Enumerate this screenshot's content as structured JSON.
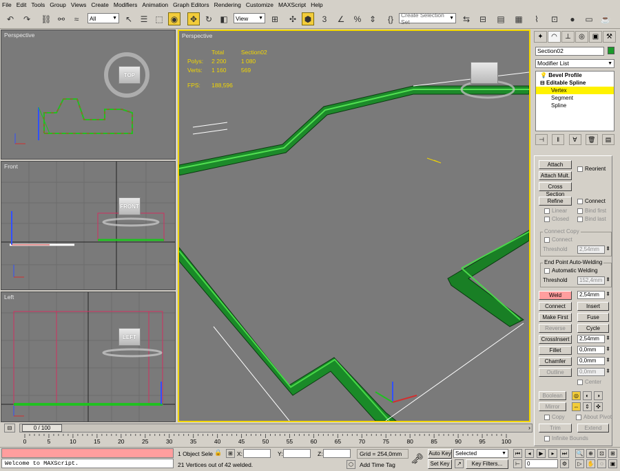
{
  "menu": [
    "File",
    "Edit",
    "Tools",
    "Group",
    "Views",
    "Create",
    "Modifiers",
    "Animation",
    "Graph Editors",
    "Rendering",
    "Customize",
    "MAXScript",
    "Help"
  ],
  "toolbar": {
    "filter": "All",
    "coord": "View",
    "selection_set": "Create Selection Set"
  },
  "viewports": {
    "top_left": "Perspective",
    "front": "Front",
    "left": "Left",
    "main": "Perspective"
  },
  "viewcube": {
    "top": "TOP",
    "front": "FRONT",
    "left": "LEFT"
  },
  "stats": {
    "col_total": "Total",
    "col_obj": "Section02",
    "polys_label": "Polys:",
    "polys_total": "2 200",
    "polys_obj": "1 080",
    "verts_label": "Verts:",
    "verts_total": "1 160",
    "verts_obj": "569",
    "fps_label": "FPS:",
    "fps": "188,596"
  },
  "panel": {
    "object_name": "Section02",
    "object_color": "#1b9a2a",
    "modifier_list": "Modifier List",
    "stack": [
      "Bevel Profile",
      "Editable Spline",
      "Vertex",
      "Segment",
      "Spline"
    ],
    "buttons": {
      "attach": "Attach",
      "attach_mult": "Attach Mult.",
      "cross_section": "Cross Section",
      "refine": "Refine",
      "weld": "Weld",
      "connect": "Connect",
      "insert": "Insert",
      "make_first": "Make First",
      "fuse": "Fuse",
      "reverse": "Reverse",
      "cycle": "Cycle",
      "crossinsert": "CrossInsert",
      "fillet": "Fillet",
      "chamfer": "Chamfer",
      "outline": "Outline",
      "boolean": "Boolean",
      "mirror": "Mirror",
      "trim": "Trim",
      "extend": "Extend"
    },
    "checks": {
      "reorient": "Reorient",
      "connect": "Connect",
      "linear": "Linear",
      "bind_first": "Bind first",
      "closed": "Closed",
      "bind_last": "Bind last",
      "connect_copy": "Connect",
      "auto_weld": "Automatic Welding",
      "center": "Center",
      "copy": "Copy",
      "about_pivot": "About Pivot",
      "infinite_bounds": "Infinite Bounds"
    },
    "groups": {
      "connect_copy": "Connect Copy",
      "end_point": "End Point Auto-Welding"
    },
    "labels": {
      "threshold": "Threshold"
    },
    "values": {
      "cc_threshold": "2,54mm",
      "ep_threshold": "152,4mm",
      "weld": "2,54mm",
      "crossinsert": "2,54mm",
      "fillet": "0,0mm",
      "chamfer": "0,0mm",
      "outline": "0,0mm"
    }
  },
  "timeline": {
    "frame": "0 / 100",
    "ticks": [
      "0",
      "5",
      "10",
      "15",
      "20",
      "25",
      "30",
      "35",
      "40",
      "45",
      "50",
      "55",
      "60",
      "65",
      "70",
      "75",
      "80",
      "85",
      "90",
      "95",
      "100"
    ]
  },
  "status": {
    "maxscript": "Welcome to MAXScript.",
    "selected": "1 Object Sele",
    "x": "X:",
    "y": "Y:",
    "z": "Z:",
    "grid": "Grid = 254,0mm",
    "prompt": "21 Vertices out of 42 welded.",
    "add_time_tag": "Add Time Tag",
    "auto_key": "Auto Key",
    "set_key": "Set Key",
    "key_mode": "Selected",
    "key_filters": "Key Filters...",
    "frame": "0"
  }
}
